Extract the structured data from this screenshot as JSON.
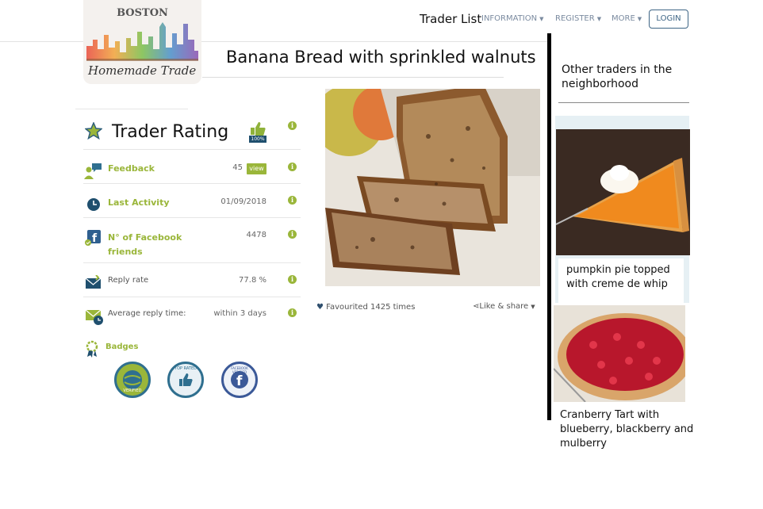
{
  "logo": {
    "city": "BOSTON",
    "brand": "Homemade Trade"
  },
  "nav": {
    "trader_list": "Trader List",
    "items": [
      {
        "label": "INFORMATION"
      },
      {
        "label": "REGISTER"
      },
      {
        "label": "MORE"
      }
    ],
    "login": "LOGIN"
  },
  "listing": {
    "title": "Banana Bread with sprinkled walnuts",
    "favourited": "Favourited 1425 times",
    "share": "Like & share"
  },
  "rating": {
    "title": "Trader Rating",
    "thumb_badge": "100%",
    "rows": [
      {
        "label": "Feedback",
        "value": "45",
        "action": "view"
      },
      {
        "label": "Last Activity",
        "value": "01/09/2018"
      },
      {
        "label": "N° of Facebook friends",
        "value": "4478"
      },
      {
        "label": "Reply rate",
        "value": "77.8 %"
      },
      {
        "label": "Average reply time:",
        "value": "within 3 days"
      }
    ],
    "badges_label": "Badges",
    "badges": [
      {
        "text": "VERIFIED",
        "color": "#2f6f8f"
      },
      {
        "text": "TOP RATED",
        "color": "#2f6f8f"
      },
      {
        "text": "FACEBOOK VERIFIED",
        "color": "#3b5998"
      }
    ]
  },
  "sidebar": {
    "title": "Other traders in the neighborhood",
    "items": [
      {
        "caption": "pumpkin pie topped with creme de whip"
      },
      {
        "caption": "Cranberry Tart with blueberry, blackberry and mulberry"
      }
    ]
  },
  "colors": {
    "accent_green": "#9ab63a",
    "nav_text": "#7b8ba0",
    "login_border": "#3e6585"
  }
}
